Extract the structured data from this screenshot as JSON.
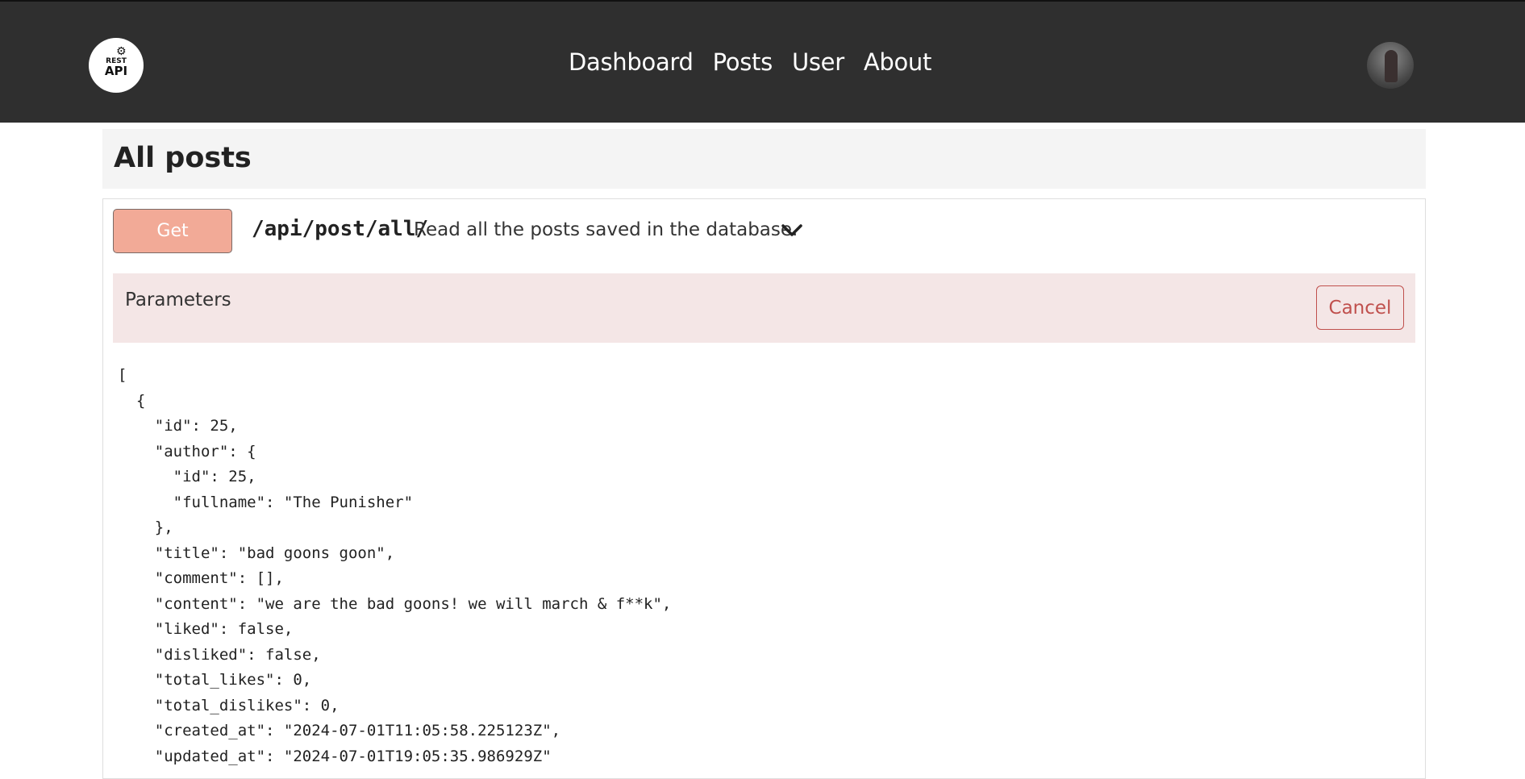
{
  "navbar": {
    "logo": {
      "text_top": "REST",
      "text_bottom": "API",
      "icon": "gear-icon"
    },
    "links": [
      "Dashboard",
      "Posts",
      "User",
      "About"
    ],
    "avatar": {
      "icon": "user-avatar"
    }
  },
  "header": {
    "title": "All posts"
  },
  "endpoint": {
    "method_label": "Get",
    "path": "/api/post/all/",
    "description": "Read all the posts saved in the database.",
    "toggle_icon": "chevron-down-icon"
  },
  "parameters": {
    "label": "Parameters",
    "cancel_label": "Cancel"
  },
  "response": {
    "json_text": "[\n  {\n    \"id\": 25,\n    \"author\": {\n      \"id\": 25,\n      \"fullname\": \"The Punisher\"\n    },\n    \"title\": \"bad goons goon\",\n    \"comment\": [],\n    \"content\": \"we are the bad goons! we will march & f**k\",\n    \"liked\": false,\n    \"disliked\": false,\n    \"total_likes\": 0,\n    \"total_dislikes\": 0,\n    \"created_at\": \"2024-07-01T11:05:58.225123Z\",\n    \"updated_at\": \"2024-07-01T19:05:35.986929Z\""
  },
  "colors": {
    "navbar_bg": "#2f2f2f",
    "get_button_bg": "#f2aa97",
    "params_bg": "#f4e6e6",
    "cancel_accent": "#c0504d",
    "header_bg": "#f4f4f4"
  }
}
